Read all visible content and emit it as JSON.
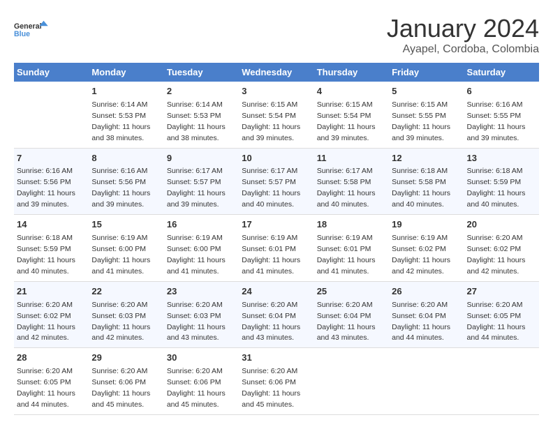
{
  "logo": {
    "line1": "General",
    "line2": "Blue"
  },
  "title": "January 2024",
  "subtitle": "Ayapel, Cordoba, Colombia",
  "headers": [
    "Sunday",
    "Monday",
    "Tuesday",
    "Wednesday",
    "Thursday",
    "Friday",
    "Saturday"
  ],
  "weeks": [
    [
      {
        "day": "",
        "sunrise": "",
        "sunset": "",
        "daylight": ""
      },
      {
        "day": "1",
        "sunrise": "Sunrise: 6:14 AM",
        "sunset": "Sunset: 5:53 PM",
        "daylight": "Daylight: 11 hours and 38 minutes."
      },
      {
        "day": "2",
        "sunrise": "Sunrise: 6:14 AM",
        "sunset": "Sunset: 5:53 PM",
        "daylight": "Daylight: 11 hours and 38 minutes."
      },
      {
        "day": "3",
        "sunrise": "Sunrise: 6:15 AM",
        "sunset": "Sunset: 5:54 PM",
        "daylight": "Daylight: 11 hours and 39 minutes."
      },
      {
        "day": "4",
        "sunrise": "Sunrise: 6:15 AM",
        "sunset": "Sunset: 5:54 PM",
        "daylight": "Daylight: 11 hours and 39 minutes."
      },
      {
        "day": "5",
        "sunrise": "Sunrise: 6:15 AM",
        "sunset": "Sunset: 5:55 PM",
        "daylight": "Daylight: 11 hours and 39 minutes."
      },
      {
        "day": "6",
        "sunrise": "Sunrise: 6:16 AM",
        "sunset": "Sunset: 5:55 PM",
        "daylight": "Daylight: 11 hours and 39 minutes."
      }
    ],
    [
      {
        "day": "7",
        "sunrise": "Sunrise: 6:16 AM",
        "sunset": "Sunset: 5:56 PM",
        "daylight": "Daylight: 11 hours and 39 minutes."
      },
      {
        "day": "8",
        "sunrise": "Sunrise: 6:16 AM",
        "sunset": "Sunset: 5:56 PM",
        "daylight": "Daylight: 11 hours and 39 minutes."
      },
      {
        "day": "9",
        "sunrise": "Sunrise: 6:17 AM",
        "sunset": "Sunset: 5:57 PM",
        "daylight": "Daylight: 11 hours and 39 minutes."
      },
      {
        "day": "10",
        "sunrise": "Sunrise: 6:17 AM",
        "sunset": "Sunset: 5:57 PM",
        "daylight": "Daylight: 11 hours and 40 minutes."
      },
      {
        "day": "11",
        "sunrise": "Sunrise: 6:17 AM",
        "sunset": "Sunset: 5:58 PM",
        "daylight": "Daylight: 11 hours and 40 minutes."
      },
      {
        "day": "12",
        "sunrise": "Sunrise: 6:18 AM",
        "sunset": "Sunset: 5:58 PM",
        "daylight": "Daylight: 11 hours and 40 minutes."
      },
      {
        "day": "13",
        "sunrise": "Sunrise: 6:18 AM",
        "sunset": "Sunset: 5:59 PM",
        "daylight": "Daylight: 11 hours and 40 minutes."
      }
    ],
    [
      {
        "day": "14",
        "sunrise": "Sunrise: 6:18 AM",
        "sunset": "Sunset: 5:59 PM",
        "daylight": "Daylight: 11 hours and 40 minutes."
      },
      {
        "day": "15",
        "sunrise": "Sunrise: 6:19 AM",
        "sunset": "Sunset: 6:00 PM",
        "daylight": "Daylight: 11 hours and 41 minutes."
      },
      {
        "day": "16",
        "sunrise": "Sunrise: 6:19 AM",
        "sunset": "Sunset: 6:00 PM",
        "daylight": "Daylight: 11 hours and 41 minutes."
      },
      {
        "day": "17",
        "sunrise": "Sunrise: 6:19 AM",
        "sunset": "Sunset: 6:01 PM",
        "daylight": "Daylight: 11 hours and 41 minutes."
      },
      {
        "day": "18",
        "sunrise": "Sunrise: 6:19 AM",
        "sunset": "Sunset: 6:01 PM",
        "daylight": "Daylight: 11 hours and 41 minutes."
      },
      {
        "day": "19",
        "sunrise": "Sunrise: 6:19 AM",
        "sunset": "Sunset: 6:02 PM",
        "daylight": "Daylight: 11 hours and 42 minutes."
      },
      {
        "day": "20",
        "sunrise": "Sunrise: 6:20 AM",
        "sunset": "Sunset: 6:02 PM",
        "daylight": "Daylight: 11 hours and 42 minutes."
      }
    ],
    [
      {
        "day": "21",
        "sunrise": "Sunrise: 6:20 AM",
        "sunset": "Sunset: 6:02 PM",
        "daylight": "Daylight: 11 hours and 42 minutes."
      },
      {
        "day": "22",
        "sunrise": "Sunrise: 6:20 AM",
        "sunset": "Sunset: 6:03 PM",
        "daylight": "Daylight: 11 hours and 42 minutes."
      },
      {
        "day": "23",
        "sunrise": "Sunrise: 6:20 AM",
        "sunset": "Sunset: 6:03 PM",
        "daylight": "Daylight: 11 hours and 43 minutes."
      },
      {
        "day": "24",
        "sunrise": "Sunrise: 6:20 AM",
        "sunset": "Sunset: 6:04 PM",
        "daylight": "Daylight: 11 hours and 43 minutes."
      },
      {
        "day": "25",
        "sunrise": "Sunrise: 6:20 AM",
        "sunset": "Sunset: 6:04 PM",
        "daylight": "Daylight: 11 hours and 43 minutes."
      },
      {
        "day": "26",
        "sunrise": "Sunrise: 6:20 AM",
        "sunset": "Sunset: 6:04 PM",
        "daylight": "Daylight: 11 hours and 44 minutes."
      },
      {
        "day": "27",
        "sunrise": "Sunrise: 6:20 AM",
        "sunset": "Sunset: 6:05 PM",
        "daylight": "Daylight: 11 hours and 44 minutes."
      }
    ],
    [
      {
        "day": "28",
        "sunrise": "Sunrise: 6:20 AM",
        "sunset": "Sunset: 6:05 PM",
        "daylight": "Daylight: 11 hours and 44 minutes."
      },
      {
        "day": "29",
        "sunrise": "Sunrise: 6:20 AM",
        "sunset": "Sunset: 6:06 PM",
        "daylight": "Daylight: 11 hours and 45 minutes."
      },
      {
        "day": "30",
        "sunrise": "Sunrise: 6:20 AM",
        "sunset": "Sunset: 6:06 PM",
        "daylight": "Daylight: 11 hours and 45 minutes."
      },
      {
        "day": "31",
        "sunrise": "Sunrise: 6:20 AM",
        "sunset": "Sunset: 6:06 PM",
        "daylight": "Daylight: 11 hours and 45 minutes."
      },
      {
        "day": "",
        "sunrise": "",
        "sunset": "",
        "daylight": ""
      },
      {
        "day": "",
        "sunrise": "",
        "sunset": "",
        "daylight": ""
      },
      {
        "day": "",
        "sunrise": "",
        "sunset": "",
        "daylight": ""
      }
    ]
  ]
}
